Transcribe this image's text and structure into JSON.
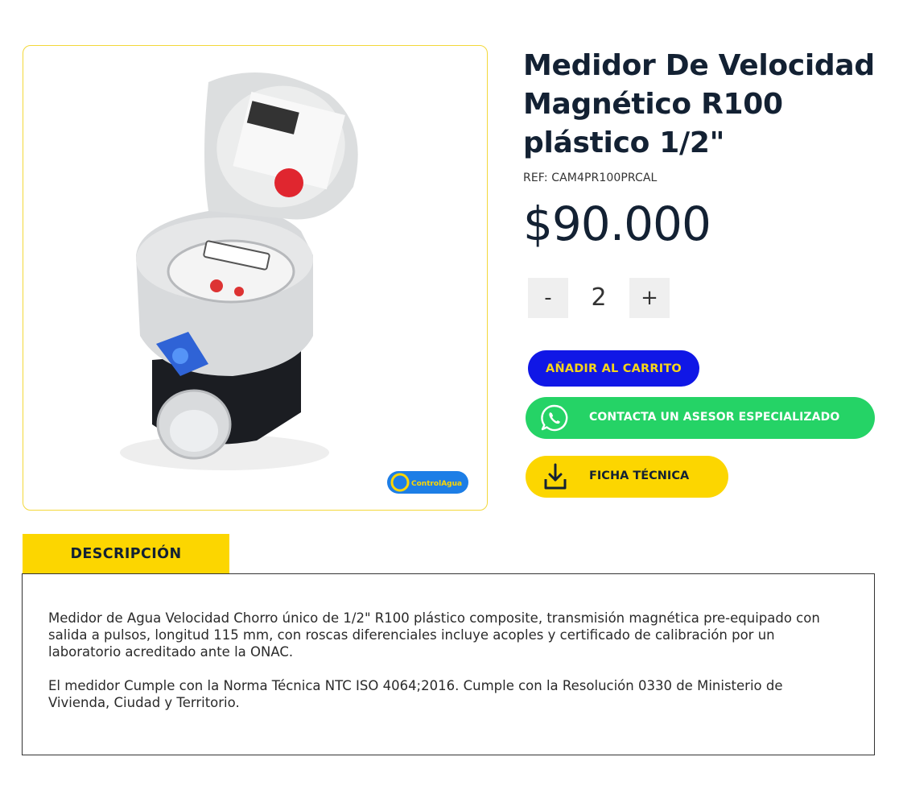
{
  "product": {
    "title": "Medidor De Velocidad Magnético R100 plástico 1/2\"",
    "ref": "REF: CAM4PR100PRCAL",
    "price": "$90.000",
    "image_logo_text": "ControlAgua"
  },
  "quantity": {
    "minus_label": "-",
    "value": "2",
    "plus_label": "+"
  },
  "actions": {
    "add_to_cart": "AÑADIR AL CARRITO",
    "contact_advisor": "CONTACTA UN ASESOR ESPECIALIZADO",
    "datasheet": "FICHA TÉCNICA"
  },
  "description": {
    "tab_label": "DESCRIPCIÓN",
    "paragraphs": [
      "Medidor de Agua Velocidad Chorro único de 1/2\" R100 plástico composite, transmisión magnética pre-equipado con salida a pulsos, longitud 115 mm, con roscas diferenciales incluye acoples y certificado de calibración por un laboratorio acreditado ante la ONAC.",
      "El medidor Cumple con la Norma Técnica NTC ISO 4064;2016. Cumple con la Resolución 0330 de Ministerio de Vivienda, Ciudad y Territorio."
    ]
  },
  "colors": {
    "accent_yellow": "#fcd600",
    "cart_blue": "#1017e6",
    "whatsapp_green": "#25d366",
    "title_navy": "#132133"
  }
}
